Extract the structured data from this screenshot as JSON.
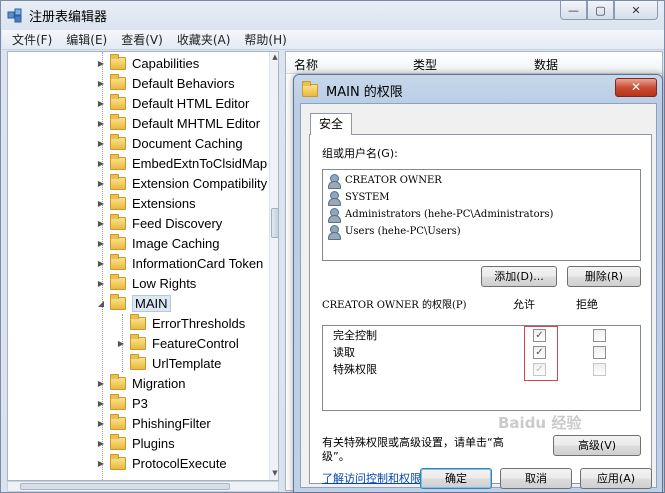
{
  "main_window": {
    "title": "注册表编辑器",
    "buttons": {
      "minimize": "—",
      "maximize": "▢",
      "close": "✕"
    }
  },
  "menu": [
    "文件(F)",
    "编辑(E)",
    "查看(V)",
    "收藏夹(A)",
    "帮助(H)"
  ],
  "tree": {
    "items": [
      {
        "label": "Capabilities",
        "expandable": true
      },
      {
        "label": "Default Behaviors",
        "expandable": true
      },
      {
        "label": "Default HTML Editor",
        "expandable": true
      },
      {
        "label": "Default MHTML Editor",
        "expandable": true
      },
      {
        "label": "Document Caching",
        "expandable": true
      },
      {
        "label": "EmbedExtnToClsidMap",
        "expandable": true
      },
      {
        "label": "Extension Compatibility",
        "expandable": true
      },
      {
        "label": "Extensions",
        "expandable": true
      },
      {
        "label": "Feed Discovery",
        "expandable": true
      },
      {
        "label": "Image Caching",
        "expandable": true
      },
      {
        "label": "InformationCard Token",
        "expandable": true
      },
      {
        "label": "Low Rights",
        "expandable": true
      },
      {
        "label": "MAIN",
        "expanded": true,
        "selected": true
      },
      {
        "label": "ErrorThresholds",
        "child": true
      },
      {
        "label": "FeatureControl",
        "child": true,
        "expandable": true
      },
      {
        "label": "UrlTemplate",
        "child": true
      },
      {
        "label": "Migration",
        "expandable": true
      },
      {
        "label": "P3",
        "expandable": true
      },
      {
        "label": "PhishingFilter",
        "expandable": true
      },
      {
        "label": "Plugins",
        "expandable": true
      },
      {
        "label": "ProtocolExecute",
        "expandable": true
      }
    ]
  },
  "columns": {
    "name": "名称",
    "type": "类型",
    "data": "数据"
  },
  "dialog": {
    "title": "MAIN 的权限",
    "close": "✕",
    "tab": "安全",
    "group_label": "组或用户名(G):",
    "users": [
      "CREATOR OWNER",
      "SYSTEM",
      "Administrators (hehe-PC\\Administrators)",
      "Users (hehe-PC\\Users)"
    ],
    "add_button": "添加(D)...",
    "remove_button": "删除(R)",
    "perm_label": "CREATOR OWNER 的权限(P)",
    "allow_header": "允许",
    "deny_header": "拒绝",
    "permissions": [
      {
        "name": "完全控制",
        "allow": true,
        "allow_disabled": false,
        "deny": false,
        "deny_disabled": false
      },
      {
        "name": "读取",
        "allow": true,
        "allow_disabled": false,
        "deny": false,
        "deny_disabled": false
      },
      {
        "name": "特殊权限",
        "allow": true,
        "allow_disabled": true,
        "deny": false,
        "deny_disabled": true
      }
    ],
    "advanced_text_1": "有关特殊权限或高级设置，请单击“高",
    "advanced_text_2": "级”。",
    "advanced_button": "高级(V)",
    "link": "了解访问控制和权限",
    "ok": "确定",
    "cancel": "取消",
    "apply": "应用(A)"
  },
  "watermark": "Baidu 经验"
}
